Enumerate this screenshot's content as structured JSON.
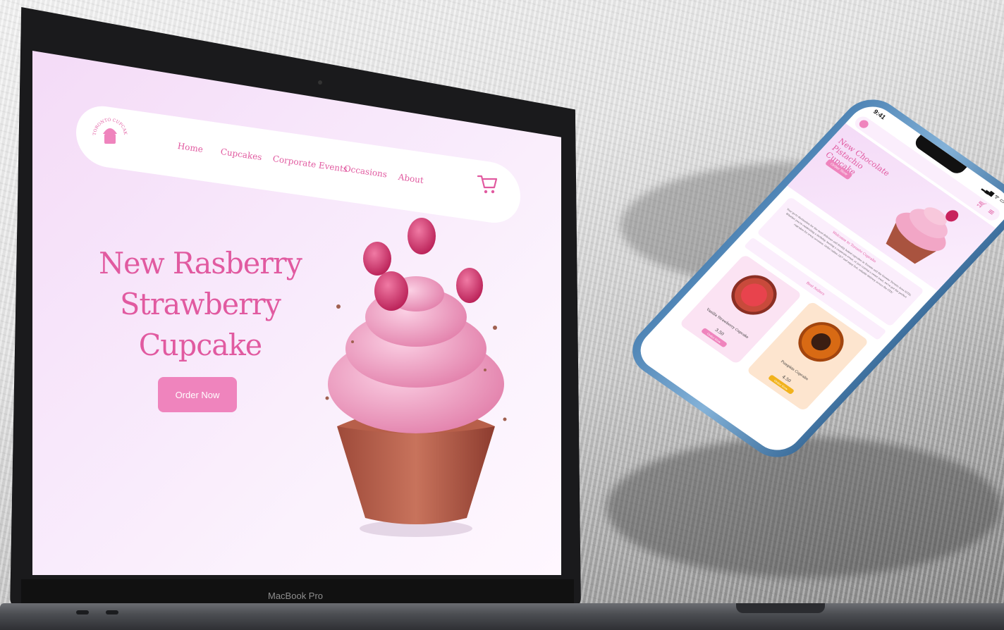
{
  "laptop": {
    "label": "MacBook Pro",
    "site": {
      "logo_text": "TORONTO CUPCAKE",
      "nav": [
        "Home",
        "Cupcakes",
        "Corporate Events",
        "Occasions",
        "About"
      ],
      "hero_title_line1": "New Rasberry",
      "hero_title_line2": "Strawberry Cupcake",
      "order_button": "Order Now"
    }
  },
  "phone": {
    "time": "9:41",
    "hero_title": "New Chocolate Pistachio Cupcake",
    "hero_button": "Order Now",
    "welcome_title": "Welcome to Toronto Cupcake",
    "welcome_text": "Your go-to destination for the most delicious and freshly baked cupcakes in Toronto and the Greater Toronto Area (GTA). Whether you're celebrating a birthday, hosting a corporate event, or just craving a sweet treat, we've got the perfect cupcakes for every occasion. Order online 24/7 and enjoy fast, reliable delivery across the GTA!",
    "best_sellers": "Best Sellers",
    "cards": [
      {
        "name": "Vanilla Strawberry Cupcake",
        "price": "3.50",
        "button": "Order Now",
        "bg": "#fbe3f3",
        "btn": "#ef84bd"
      },
      {
        "name": "Pumpkin Cupcake",
        "price": "4.50",
        "button": "Order Now",
        "bg": "#fde5cf",
        "btn": "#f1b21c"
      }
    ]
  },
  "colors": {
    "brand_pink": "#e15aa0",
    "button_pink": "#ef84bd"
  }
}
